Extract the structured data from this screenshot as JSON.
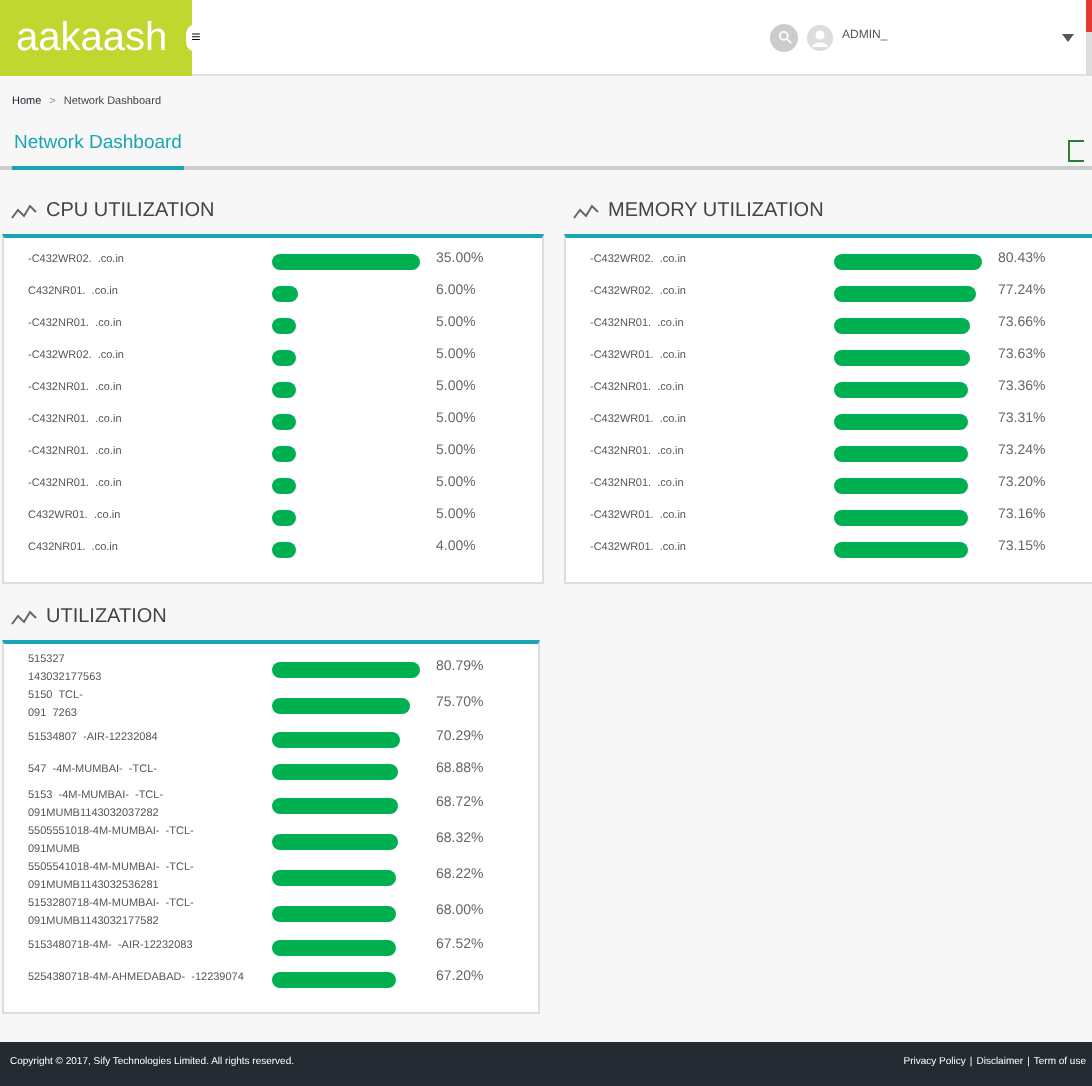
{
  "header": {
    "logo": "aakaash",
    "menu_glyph": "≡",
    "user": "ADMIN_"
  },
  "breadcrumb": [
    "Home",
    ">",
    "Network Dashboard"
  ],
  "page_title": "Network Dashboard",
  "panels": [
    {
      "title": "CPU UTILIZATION",
      "rows": [
        {
          "lines": [
            "-C432WR02.  .co.in"
          ],
          "reading": "35.00%"
        },
        {
          "lines": [
            "C432NR01.  .co.in"
          ],
          "reading": "6.00%"
        },
        {
          "lines": [
            "-C432NR01.  .co.in"
          ],
          "reading": "5.00%"
        },
        {
          "lines": [
            "-C432WR02.  .co.in"
          ],
          "reading": "5.00%"
        },
        {
          "lines": [
            "-C432NR01.  .co.in"
          ],
          "reading": "5.00%"
        },
        {
          "lines": [
            "-C432NR01.  .co.in"
          ],
          "reading": "5.00%"
        },
        {
          "lines": [
            "-C432NR01.  .co.in"
          ],
          "reading": "5.00%"
        },
        {
          "lines": [
            "-C432NR01.  .co.in"
          ],
          "reading": "5.00%"
        },
        {
          "lines": [
            "C432WR01.  .co.in"
          ],
          "reading": "5.00%"
        },
        {
          "lines": [
            "C432NR01.  .co.in"
          ],
          "reading": "4.00%"
        }
      ]
    },
    {
      "title": "MEMORY UTILIZATION",
      "rows": [
        {
          "lines": [
            "-C432WR02.  .co.in"
          ],
          "reading": "80.43%"
        },
        {
          "lines": [
            "-C432WR02.  .co.in"
          ],
          "reading": "77.24%"
        },
        {
          "lines": [
            "-C432NR01.  .co.in"
          ],
          "reading": "73.66%"
        },
        {
          "lines": [
            "-C432WR01.  .co.in"
          ],
          "reading": "73.63%"
        },
        {
          "lines": [
            "-C432NR01.  .co.in"
          ],
          "reading": "73.36%"
        },
        {
          "lines": [
            "-C432WR01.  .co.in"
          ],
          "reading": "73.31%"
        },
        {
          "lines": [
            "-C432NR01.  .co.in"
          ],
          "reading": "73.24%"
        },
        {
          "lines": [
            "-C432NR01.  .co.in"
          ],
          "reading": "73.20%"
        },
        {
          "lines": [
            "-C432WR01.  .co.in"
          ],
          "reading": "73.16%"
        },
        {
          "lines": [
            "-C432WR01.  .co.in"
          ],
          "reading": "73.15%"
        }
      ]
    },
    {
      "title": "UTILIZATION",
      "rows": [
        {
          "lines": [
            "515327",
            "143032177563"
          ],
          "reading": "80.79%"
        },
        {
          "lines": [
            "5150  TCL-",
            "091  7263"
          ],
          "reading": "75.70%"
        },
        {
          "lines": [
            "51534807  -AIR-12232084"
          ],
          "reading": "70.29%"
        },
        {
          "lines": [
            "547  -4M-MUMBAI-  -TCL-"
          ],
          "reading": "68.88%"
        },
        {
          "lines": [
            "5153  -4M-MUMBAI-  -TCL-",
            "091MUMB1143032037282"
          ],
          "reading": "68.72%"
        },
        {
          "lines": [
            "5505551018-4M-MUMBAI-  -TCL-",
            "091MUMB"
          ],
          "reading": "68.32%"
        },
        {
          "lines": [
            "5505541018-4M-MUMBAI-  -TCL-",
            "091MUMB1143032536281"
          ],
          "reading": "68.22%"
        },
        {
          "lines": [
            "5153280718-4M-MUMBAI-  -TCL-",
            "091MUMB1143032177582"
          ],
          "reading": "68.00%"
        },
        {
          "lines": [
            "5153480718-4M-  -AIR-12232083"
          ],
          "reading": "67.52%"
        },
        {
          "lines": [
            "5254380718-4M-AHMEDABAD-  -12239074"
          ],
          "reading": "67.20%"
        }
      ]
    }
  ],
  "footer": {
    "copyright": "Copyright © 2017, Sify Technologies Limited. All rights reserved.",
    "links": [
      "Privacy Policy",
      "Disclaimer",
      "Term of use"
    ],
    "separator": "|"
  }
}
